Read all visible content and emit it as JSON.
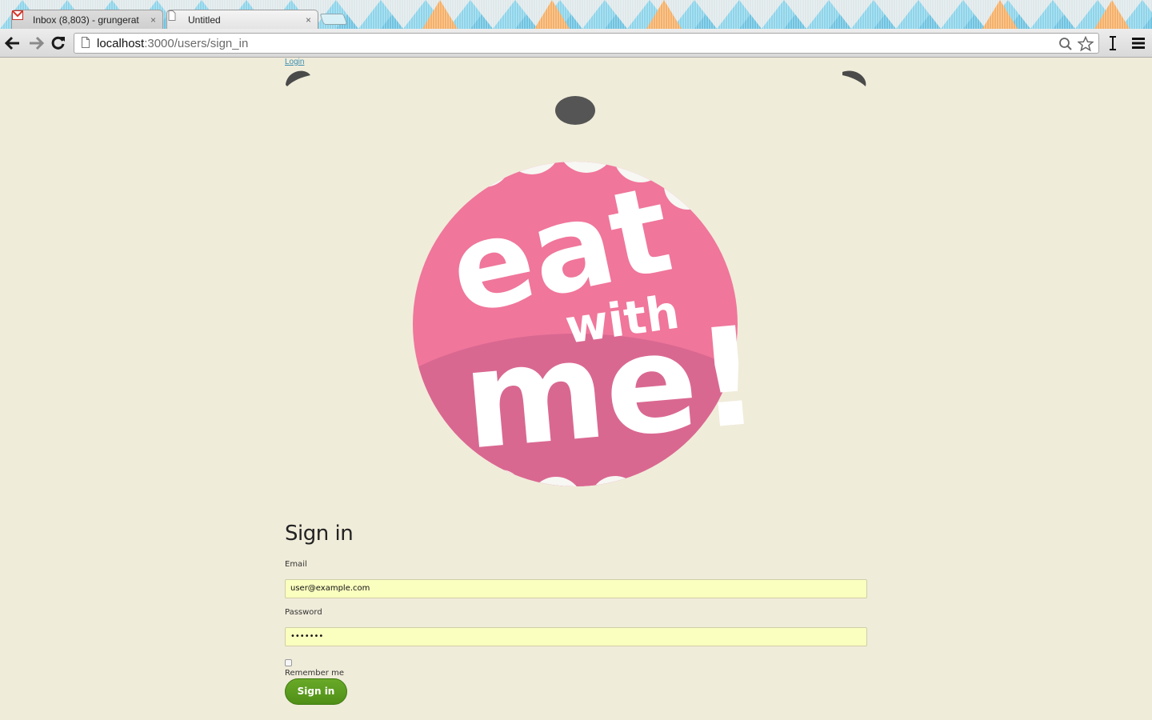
{
  "browser": {
    "tabs": [
      {
        "title": "Inbox (8,803) - grungerat",
        "close": "×"
      },
      {
        "title": "Untitled",
        "close": "×"
      }
    ],
    "url_host": "localhost",
    "url_path": ":3000/users/sign_in"
  },
  "page": {
    "login_link": "Login",
    "logo_text": {
      "line1": "eat",
      "line2": "with",
      "line3": "me!"
    },
    "form": {
      "title": "Sign in",
      "email_label": "Email",
      "email_value": "user@example.com",
      "password_label": "Password",
      "password_value": "•••••••",
      "remember_label": "Remember me",
      "remember_checked": false,
      "submit_label": "Sign in"
    }
  },
  "colors": {
    "page_bg": "#f0ecda",
    "logo_pink": "#f0769b",
    "logo_pink_dark": "#d76891",
    "button_green": "#5c9e1f",
    "input_autofill": "#fafebf"
  }
}
